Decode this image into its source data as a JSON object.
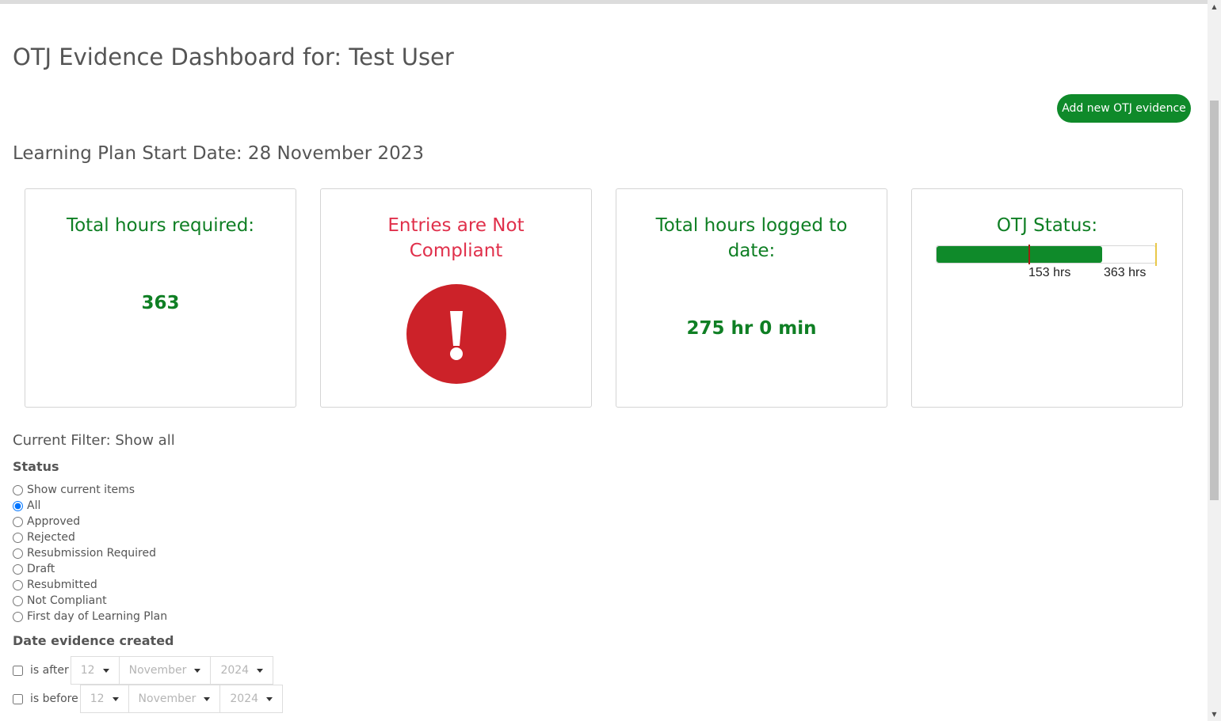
{
  "header": {
    "title": "OTJ Evidence Dashboard for: Test User",
    "add_button": "Add new OTJ evidence",
    "start_date": "Learning Plan Start Date: 28 November 2023"
  },
  "cards": {
    "required": {
      "title": "Total hours required:",
      "value": "363"
    },
    "compliance": {
      "title": "Entries are Not Compliant",
      "icon": "exclamation-alert-icon"
    },
    "logged": {
      "title": "Total hours logged to date:",
      "value": "275 hr 0 min"
    },
    "status": {
      "title": "OTJ Status:",
      "progress_fraction": 0.757,
      "marker_fraction": 0.421,
      "marker_label": "153 hrs",
      "target_label": "363 hrs"
    }
  },
  "filter": {
    "current": "Current Filter: Show all",
    "status_label": "Status",
    "options": [
      {
        "label": "Show current items",
        "checked": false
      },
      {
        "label": "All",
        "checked": true
      },
      {
        "label": "Approved",
        "checked": false
      },
      {
        "label": "Rejected",
        "checked": false
      },
      {
        "label": "Resubmission Required",
        "checked": false
      },
      {
        "label": "Draft",
        "checked": false
      },
      {
        "label": "Resubmitted",
        "checked": false
      },
      {
        "label": "Not Compliant",
        "checked": false
      },
      {
        "label": "First day of Learning Plan",
        "checked": false
      }
    ],
    "date_label": "Date evidence created",
    "after": {
      "label": "is after",
      "day": "12",
      "month": "November",
      "year": "2024"
    },
    "before": {
      "label": "is before",
      "day": "12",
      "month": "November",
      "year": "2024"
    }
  },
  "colors": {
    "brand_green": "#0f8a2a",
    "alert_red": "#cc2229",
    "title_red": "#e0304b",
    "marker": "#a0200f"
  }
}
